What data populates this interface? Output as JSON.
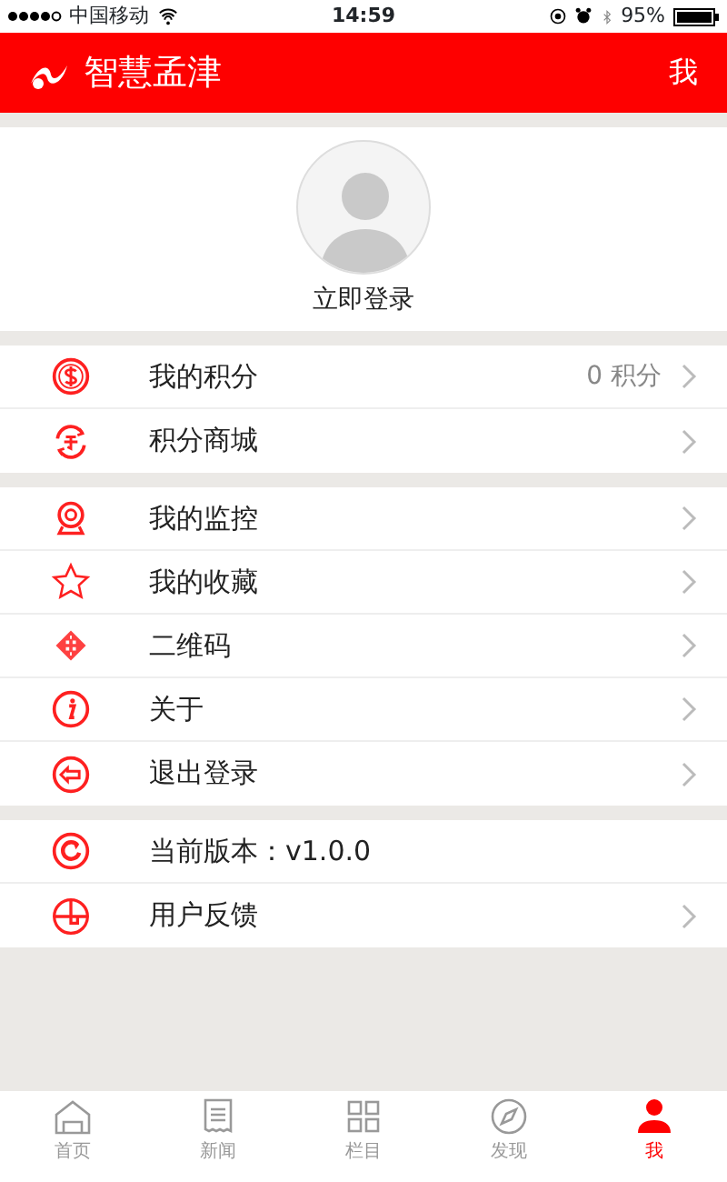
{
  "status_bar": {
    "carrier": "中国移动",
    "time": "14:59",
    "battery": "95%"
  },
  "header": {
    "title": "智慧孟津",
    "action": "我"
  },
  "profile": {
    "login": "立即登录"
  },
  "groups": [
    {
      "items": [
        {
          "label": "我的积分",
          "value": "0 积分",
          "chevron": true
        },
        {
          "label": "积分商城",
          "chevron": true
        }
      ]
    },
    {
      "items": [
        {
          "label": "我的监控",
          "chevron": true
        },
        {
          "label": "我的收藏",
          "chevron": true
        },
        {
          "label": "二维码",
          "chevron": true
        },
        {
          "label": "关于",
          "chevron": true
        },
        {
          "label": "退出登录",
          "chevron": true
        }
      ]
    },
    {
      "items": [
        {
          "label": "当前版本：v1.0.0",
          "chevron": false
        },
        {
          "label": "用户反馈",
          "chevron": true
        }
      ]
    }
  ],
  "tabs": [
    {
      "label": "首页",
      "selected": false
    },
    {
      "label": "新闻",
      "selected": false
    },
    {
      "label": "栏目",
      "selected": false
    },
    {
      "label": "发现",
      "selected": false
    },
    {
      "label": "我",
      "selected": true
    }
  ]
}
